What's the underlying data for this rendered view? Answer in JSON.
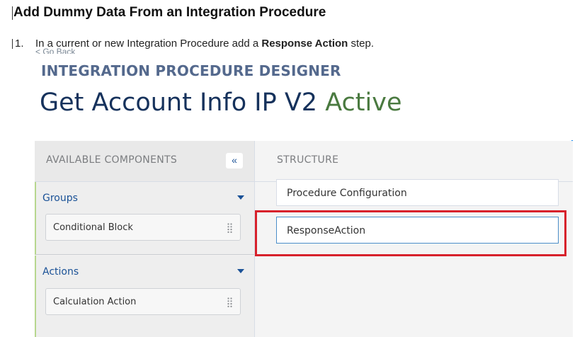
{
  "doc": {
    "heading": "Add Dummy Data From an Integration Procedure",
    "step_number": "1.",
    "step_text_before": "In a current or new Integration Procedure add a ",
    "step_text_bold": "Response Action",
    "step_text_after": " step."
  },
  "header": {
    "go_back": "< Go Back",
    "designer_title": "INTEGRATION PROCEDURE DESIGNER",
    "procedure_name": "Get Account Info IP V2",
    "status": "Active"
  },
  "left_panel": {
    "title": "AVAILABLE COMPONENTS",
    "collapse_glyph": "«",
    "groups": [
      {
        "label": "Groups",
        "items": [
          "Conditional Block"
        ]
      },
      {
        "label": "Actions",
        "items": [
          "Calculation Action"
        ]
      }
    ]
  },
  "structure": {
    "title": "STRUCTURE",
    "items": [
      "Procedure Configuration",
      "ResponseAction"
    ]
  },
  "colors": {
    "highlight": "#d7212b",
    "status_green": "#4a7a40",
    "title_navy": "#16325c",
    "link_blue": "#1b5297"
  }
}
